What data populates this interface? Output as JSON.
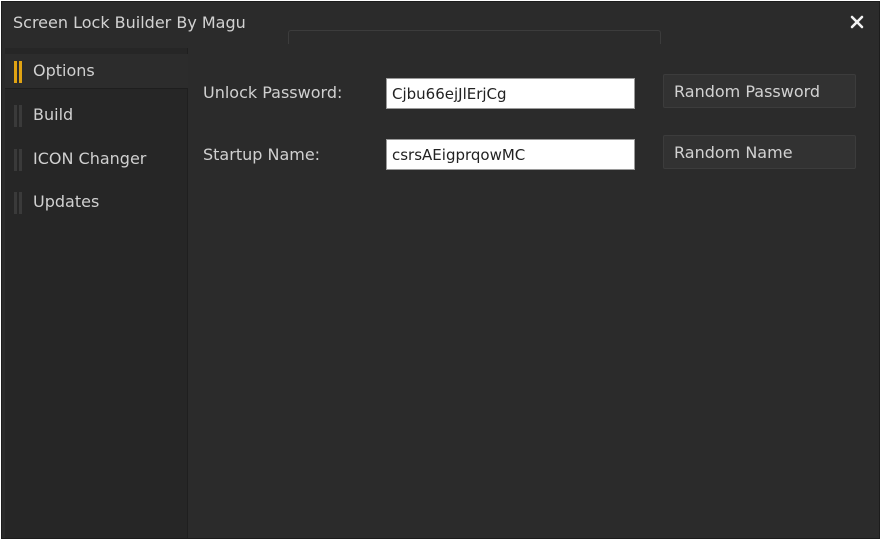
{
  "window": {
    "title": "Screen Lock Builder By Magu",
    "accent_color": "#e0a313",
    "background_color": "#2b2b2b",
    "close_icon": "close-icon"
  },
  "sidebar": {
    "items": [
      {
        "label": "Options",
        "active": true
      },
      {
        "label": "Build",
        "active": false
      },
      {
        "label": "ICON Changer",
        "active": false
      },
      {
        "label": "Updates",
        "active": false
      }
    ]
  },
  "options": {
    "unlock_password": {
      "label": "Unlock Password:",
      "value": "Cjbu66ejJlErjCg"
    },
    "startup_name": {
      "label": "Startup Name:",
      "value": "csrsAEigprqowMC"
    },
    "random_password_label": "Random Password",
    "random_name_label": "Random Name"
  }
}
